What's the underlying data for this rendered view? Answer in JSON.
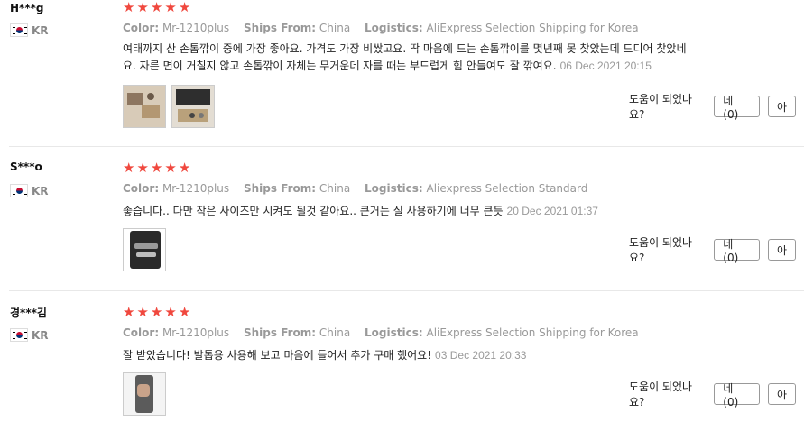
{
  "reviews": [
    {
      "user": "H***g",
      "country": "KR",
      "rating": 5,
      "color_label": "Color:",
      "color_value": "Mr-1210plus",
      "ships_label": "Ships From:",
      "ships_value": "China",
      "logistics_label": "Logistics:",
      "logistics_value": "AliExpress Selection Shipping for Korea",
      "text_line1": "여태까지 산 손톱깎이 중에 가장 좋아요. 가격도 가장 비쌌고요. 딱 마음에 드는 손톱깎이를 몇년째 못 찾았는데 드디어 찾았네",
      "text_line2": "요. 자른 면이 거칠지 않고 손톱깎이 자체는 무거운데 자를 때는 부드럽게 힘 안들여도 잘 깎여요.",
      "date": "06 Dec 2021 20:15",
      "helpful_question": "도움이 되었나요?",
      "yes_label": "네 (0)",
      "no_label": "아"
    },
    {
      "user": "S***o",
      "country": "KR",
      "rating": 5,
      "color_label": "Color:",
      "color_value": "Mr-1210plus",
      "ships_label": "Ships From:",
      "ships_value": "China",
      "logistics_label": "Logistics:",
      "logistics_value": "Aliexpress Selection Standard",
      "text_line1": "좋습니다.. 다만 작은 사이즈만 시켜도 될것 같아요.. 큰거는 실 사용하기에 너무 큰듯",
      "text_line2": "",
      "date": "20 Dec 2021 01:37",
      "helpful_question": "도움이 되었나요?",
      "yes_label": "네 (0)",
      "no_label": "아"
    },
    {
      "user": "경***김",
      "country": "KR",
      "rating": 5,
      "color_label": "Color:",
      "color_value": "Mr-1210plus",
      "ships_label": "Ships From:",
      "ships_value": "China",
      "logistics_label": "Logistics:",
      "logistics_value": "AliExpress Selection Shipping for Korea",
      "text_line1": "잘 받았습니다! 발톱용 사용해 보고 마음에 들어서 추가 구매 했어요!",
      "text_line2": "",
      "date": "03 Dec 2021 20:33",
      "helpful_question": "도움이 되었나요?",
      "yes_label": "네 (0)",
      "no_label": "아"
    }
  ],
  "colors": {
    "star": "#f0483e",
    "meta": "#999999"
  }
}
